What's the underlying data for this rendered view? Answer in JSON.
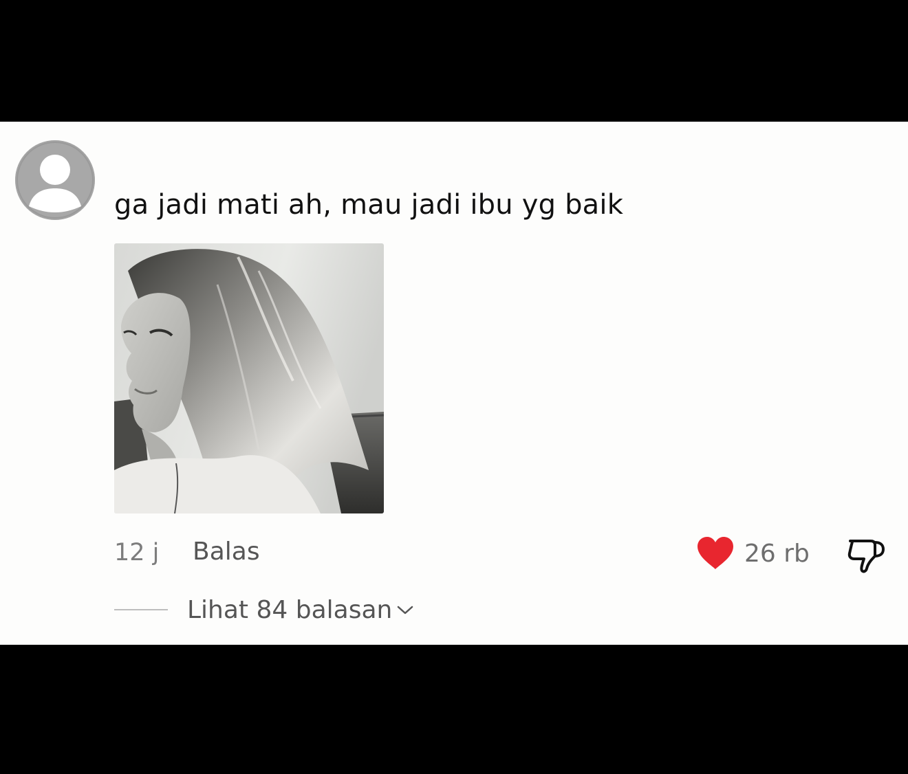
{
  "comment": {
    "text": "ga jadi mati ah, mau jadi ibu yg baik",
    "time": "12 j",
    "reply_label": "Balas",
    "like_count": "26 rb",
    "view_replies_label": "Lihat 84 balasan"
  },
  "icons": {
    "avatar": "default-user-avatar",
    "like": "heart-icon",
    "dislike": "thumbs-down-icon",
    "expand": "chevron-down-icon"
  },
  "colors": {
    "like_heart": "#e8262f",
    "background": "#fdfdfc",
    "letterbox": "#000000"
  }
}
